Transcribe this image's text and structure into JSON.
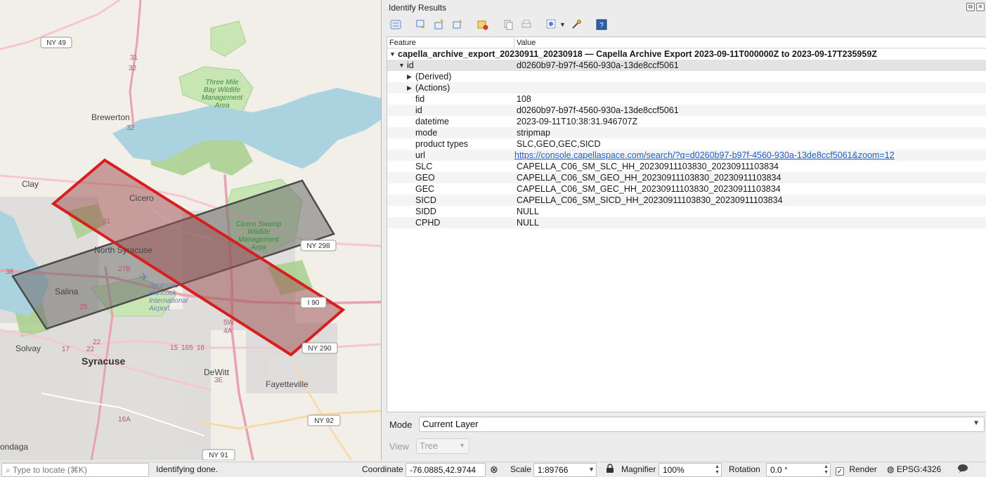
{
  "map": {
    "places": {
      "brewerton": "Brewerton",
      "clay": "Clay",
      "cicero": "Cicero",
      "north_syracuse": "North Syracuse",
      "salina": "Salina",
      "syracuse": "Syracuse",
      "solvay": "Solvay",
      "dewitt": "DeWitt",
      "fayetteville": "Fayetteville",
      "onondaga": "ondaga",
      "airport": "Syracuse Hancock International Airport",
      "three_mile_bay": "Three Mile Bay Wildlife Management Area",
      "cicero_swamp": "Cicero Swamp Wildlife Management Area"
    },
    "shields": {
      "ny49": "NY 49",
      "ny298": "NY 298",
      "i90": "I 90",
      "ny290": "NY 290",
      "ny92": "NY 92",
      "ny91": "NY 91"
    },
    "exits": [
      "31",
      "32",
      "32",
      "31",
      "38",
      "25",
      "22",
      "17",
      "16",
      "15",
      "165",
      "27B",
      "22",
      "3E",
      "5W",
      "4A",
      "16A"
    ]
  },
  "panel": {
    "title": "Identify Results",
    "toolbar_icons": [
      "expand-tree-icon",
      "expand-all-icon",
      "collapse-all-icon",
      "expand-new-icon",
      "clear-results-icon",
      "copy-icon",
      "print-icon",
      "select-features-icon",
      "attribute-tool-icon",
      "help-icon"
    ],
    "columns": {
      "feature": "Feature",
      "value": "Value"
    },
    "layer_row": "capella_archive_export_20230911_20230918 — Capella Archive Export 2023-09-11T000000Z to 2023-09-17T235959Z",
    "id_row": {
      "key": "id",
      "value": "d0260b97-b97f-4560-930a-13de8ccf5061"
    },
    "groups": [
      "(Derived)",
      "(Actions)"
    ],
    "attributes": [
      {
        "key": "fid",
        "value": "108"
      },
      {
        "key": "id",
        "value": "d0260b97-b97f-4560-930a-13de8ccf5061"
      },
      {
        "key": "datetime",
        "value": "2023-09-11T10:38:31.946707Z"
      },
      {
        "key": "mode",
        "value": "stripmap"
      },
      {
        "key": "product types",
        "value": "SLC,GEO,GEC,SICD"
      },
      {
        "key": "url",
        "value": "https://console.capellaspace.com/search/?q=d0260b97-b97f-4560-930a-13de8ccf5061&zoom=12"
      },
      {
        "key": "SLC",
        "value": "CAPELLA_C06_SM_SLC_HH_20230911103830_20230911103834"
      },
      {
        "key": "GEO",
        "value": "CAPELLA_C06_SM_GEO_HH_20230911103830_20230911103834"
      },
      {
        "key": "GEC",
        "value": "CAPELLA_C06_SM_GEC_HH_20230911103830_20230911103834"
      },
      {
        "key": "SICD",
        "value": "CAPELLA_C06_SM_SICD_HH_20230911103830_20230911103834"
      },
      {
        "key": "SIDD",
        "value": "NULL"
      },
      {
        "key": "CPHD",
        "value": "NULL"
      }
    ],
    "mode_label": "Mode",
    "mode_value": "Current Layer",
    "view_label": "View",
    "view_value": "Tree"
  },
  "status": {
    "locate_placeholder": "Type to locate (⌘K)",
    "message": "Identifying done.",
    "coordinate_label": "Coordinate",
    "coordinate_value": "-76.0885,42.9744",
    "scale_label": "Scale",
    "scale_value": "1:89766",
    "magnifier_label": "Magnifier",
    "magnifier_value": "100%",
    "rotation_label": "Rotation",
    "rotation_value": "0.0 °",
    "render_label": "Render",
    "render_checked": true,
    "crs": "EPSG:4326"
  },
  "colors": {
    "accent_link": "#1f5fbf",
    "footprint_red": "#d81e1e",
    "footprint_gray": "#4a4a4a",
    "lake": "#aad3df",
    "park": "#c8e6b4"
  }
}
